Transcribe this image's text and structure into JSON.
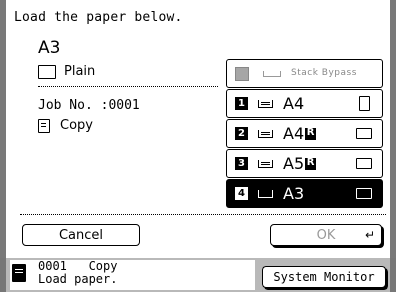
{
  "message": "Load the paper below.",
  "paper": {
    "size": "A3",
    "type": "Plain"
  },
  "job": {
    "number_label": "Job No. :0001",
    "type": "Copy"
  },
  "sources": [
    {
      "number": "",
      "label": "Stack Bypass",
      "size": "",
      "state": "disabled"
    },
    {
      "number": "1",
      "size": "A4",
      "rotated": false,
      "orientation": "portrait",
      "state": "normal"
    },
    {
      "number": "2",
      "size": "A4",
      "rotated": true,
      "orientation": "landscape",
      "state": "normal"
    },
    {
      "number": "3",
      "size": "A5",
      "rotated": true,
      "orientation": "landscape",
      "state": "normal"
    },
    {
      "number": "4",
      "size": "A3",
      "rotated": false,
      "orientation": "landscape",
      "state": "selected"
    }
  ],
  "buttons": {
    "cancel": "Cancel",
    "ok": "OK"
  },
  "status": {
    "line1": "0001   Copy",
    "line2": "Load paper."
  },
  "system_monitor": "System Monitor"
}
